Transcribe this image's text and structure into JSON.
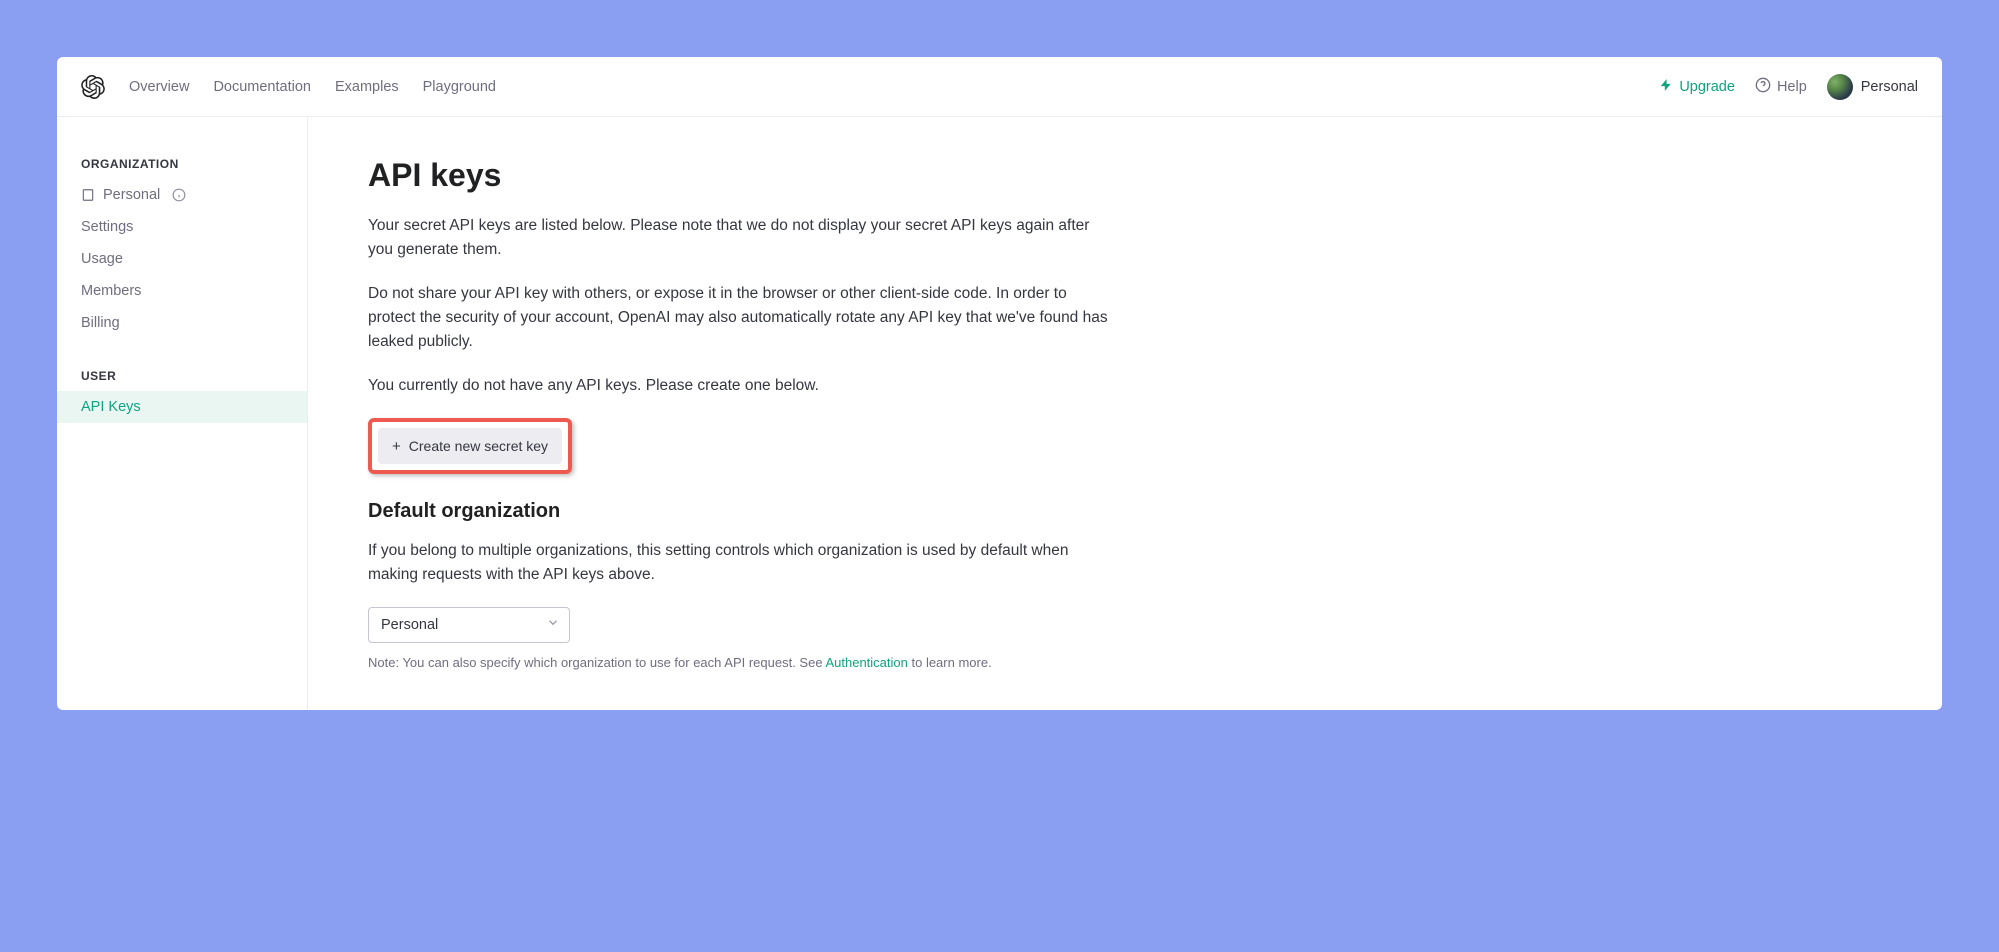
{
  "header": {
    "nav": {
      "overview": "Overview",
      "documentation": "Documentation",
      "examples": "Examples",
      "playground": "Playground"
    },
    "upgrade": "Upgrade",
    "help": "Help",
    "profile": "Personal"
  },
  "sidebar": {
    "org_header": "ORGANIZATION",
    "personal": "Personal",
    "settings": "Settings",
    "usage": "Usage",
    "members": "Members",
    "billing": "Billing",
    "user_header": "USER",
    "api_keys": "API Keys"
  },
  "main": {
    "title": "API keys",
    "para1": "Your secret API keys are listed below. Please note that we do not display your secret API keys again after you generate them.",
    "para2": "Do not share your API key with others, or expose it in the browser or other client-side code. In order to protect the security of your account, OpenAI may also automatically rotate any API key that we've found has leaked publicly.",
    "para3": "You currently do not have any API keys. Please create one below.",
    "create_label": "Create new secret key",
    "default_org_heading": "Default organization",
    "default_org_para": "If you belong to multiple organizations, this setting controls which organization is used by default when making requests with the API keys above.",
    "org_select_value": "Personal",
    "note_prefix": "Note: You can also specify which organization to use for each API request. See ",
    "note_link": "Authentication",
    "note_suffix": " to learn more."
  }
}
